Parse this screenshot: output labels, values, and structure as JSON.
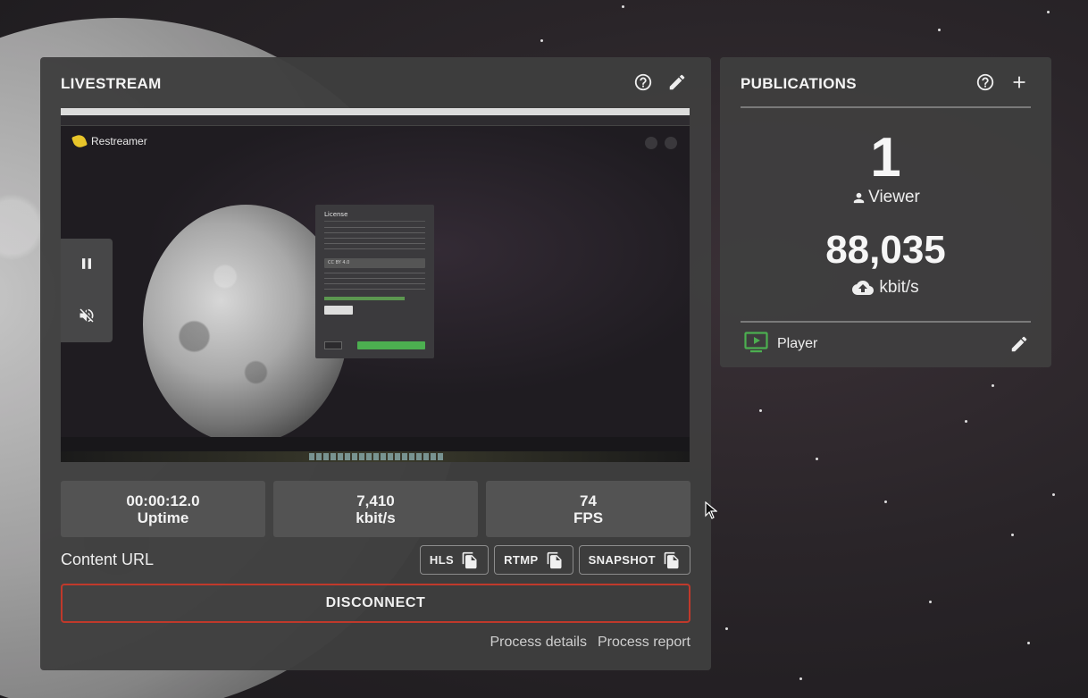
{
  "livestream": {
    "title": "LIVESTREAM",
    "icons": {
      "help": "help-circle-icon",
      "edit": "pencil-icon"
    },
    "preview": {
      "app_logo": "Restreamer",
      "dialog_title": "License",
      "dialog_select_value": "CC BY 4.0",
      "controls": {
        "pause": "pause-icon",
        "mute": "volume-off-icon"
      }
    },
    "stats": [
      {
        "value": "00:00:12.0",
        "label": "Uptime"
      },
      {
        "value": "7,410",
        "label": "kbit/s"
      },
      {
        "value": "74",
        "label": "FPS"
      }
    ],
    "content_url_label": "Content URL",
    "url_buttons": [
      {
        "label": "HLS",
        "icon": "copy-icon"
      },
      {
        "label": "RTMP",
        "icon": "copy-icon"
      },
      {
        "label": "SNAPSHOT",
        "icon": "copy-icon"
      }
    ],
    "disconnect_label": "DISCONNECT",
    "footer_links": [
      "Process details",
      "Process report"
    ]
  },
  "publications": {
    "title": "PUBLICATIONS",
    "icons": {
      "help": "help-circle-icon",
      "add": "plus-icon"
    },
    "viewers_count": "1",
    "viewers_label": "Viewer",
    "bitrate_value": "88,035",
    "bitrate_unit": "kbit/s",
    "player_label": "Player",
    "player_icon_color": "#4caf50"
  },
  "colors": {
    "disconnect_border": "#c0392b",
    "accent_green": "#4caf50"
  }
}
